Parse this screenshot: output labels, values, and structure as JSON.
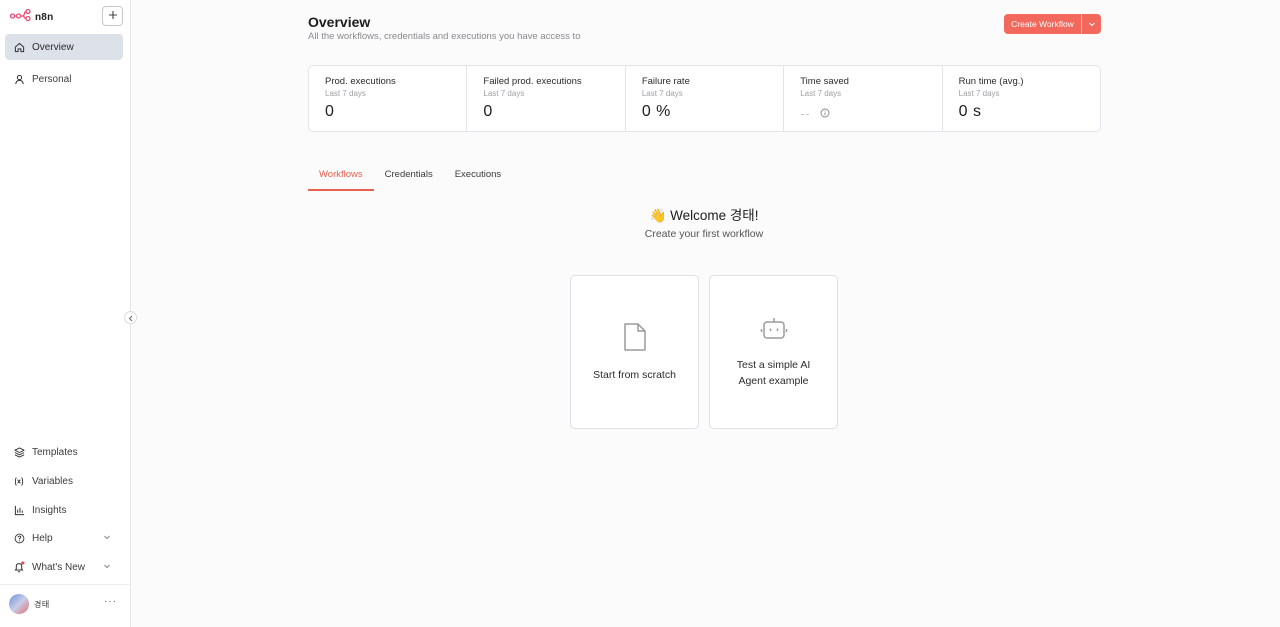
{
  "sidebar": {
    "brand": "n8n",
    "nav": [
      {
        "label": "Overview"
      },
      {
        "label": "Personal"
      }
    ],
    "bottom": [
      {
        "label": "Templates"
      },
      {
        "label": "Variables"
      },
      {
        "label": "Insights"
      },
      {
        "label": "Help"
      },
      {
        "label": "What's New"
      }
    ],
    "user": {
      "name": "경태 ",
      "more": "···"
    }
  },
  "header": {
    "title": "Overview",
    "subtitle": "All the workflows, credentials and executions you have access to",
    "create_button": "Create Workflow"
  },
  "stats": [
    {
      "label": "Prod. executions",
      "period": "Last 7 days",
      "value": "0"
    },
    {
      "label": "Failed prod. executions",
      "period": "Last 7 days",
      "value": "0"
    },
    {
      "label": "Failure rate",
      "period": "Last 7 days",
      "value": "0 %"
    },
    {
      "label": "Time saved",
      "period": "Last 7 days",
      "value": "--"
    },
    {
      "label": "Run time (avg.)",
      "period": "Last 7 days",
      "value": "0 s"
    }
  ],
  "tabs": [
    {
      "label": "Workflows"
    },
    {
      "label": "Credentials"
    },
    {
      "label": "Executions"
    }
  ],
  "welcome": {
    "title": "👋 Welcome 경태!",
    "subtitle": "Create your first workflow"
  },
  "cards": [
    {
      "label": "Start from scratch"
    },
    {
      "label_line1": "Test a simple AI",
      "label_line2": "Agent example"
    }
  ],
  "colors": {
    "accent": "#f2685c",
    "active_nav": "#dde1ea"
  }
}
